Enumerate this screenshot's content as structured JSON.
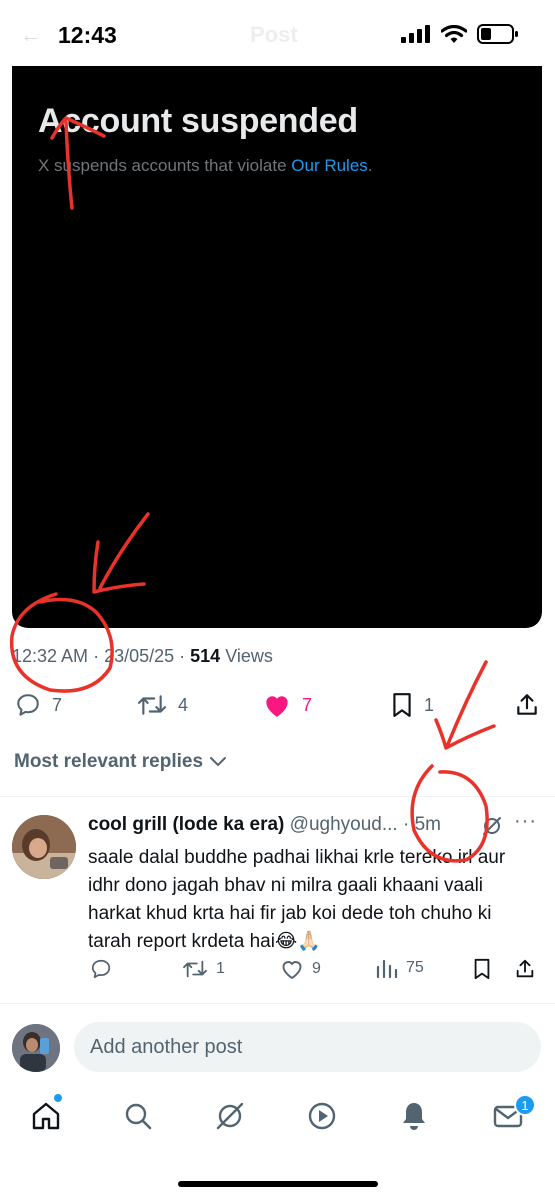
{
  "status_bar": {
    "time": "12:43"
  },
  "header": {
    "back_glyph": "←",
    "title": "Post"
  },
  "media": {
    "title": "Account suspended",
    "subtitle_prefix": "X suspends accounts that violate ",
    "subtitle_link": "Our Rules",
    "subtitle_suffix": "."
  },
  "post_meta": {
    "time": "12:32 AM",
    "date": "23/05/25",
    "views_count": "514",
    "views_label": "Views"
  },
  "actions": {
    "replies": "7",
    "reposts": "4",
    "likes": "7",
    "bookmarks": "1"
  },
  "replies_filter": {
    "label": "Most relevant replies"
  },
  "reply": {
    "name": "cool grill (lode ka era)",
    "handle": "@ughyoud...",
    "time": "5m",
    "text": "saale dalal buddhe padhai likhai krle tereko irl aur idhr dono jagah bhav ni milra gaali khaani vaali harkat khud krta hai fir jab koi dede toh chuho ki tarah report krdeta hai😂🙏🏻",
    "reposts": "1",
    "likes": "9",
    "views": "75"
  },
  "composer": {
    "placeholder": "Add another post"
  },
  "nav": {
    "messages_badge": "1"
  },
  "colors": {
    "accent": "#1d9bf0",
    "like": "#f91880",
    "annotation": "#e8322a"
  }
}
